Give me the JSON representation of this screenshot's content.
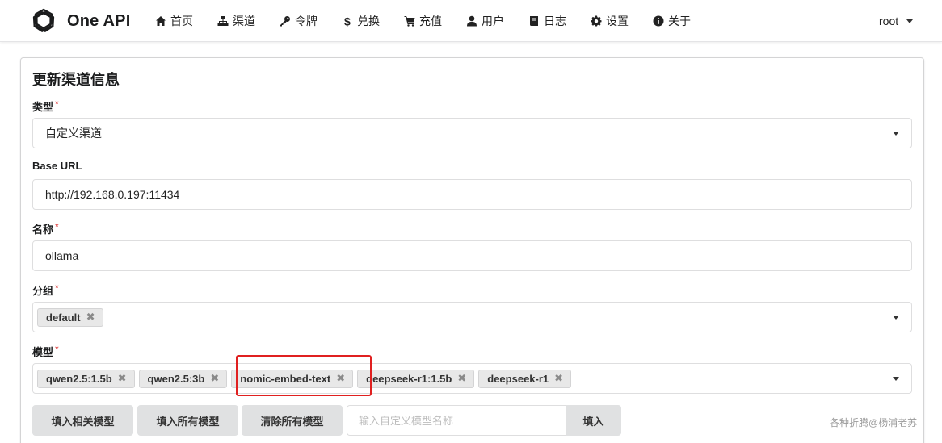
{
  "brand": {
    "name": "One API"
  },
  "nav": {
    "items": [
      {
        "label": "首页",
        "icon": "home-icon"
      },
      {
        "label": "渠道",
        "icon": "sitemap-icon"
      },
      {
        "label": "令牌",
        "icon": "key-icon"
      },
      {
        "label": "兑换",
        "icon": "dollar-icon"
      },
      {
        "label": "充值",
        "icon": "cart-icon"
      },
      {
        "label": "用户",
        "icon": "user-icon"
      },
      {
        "label": "日志",
        "icon": "book-icon"
      },
      {
        "label": "设置",
        "icon": "gear-icon"
      },
      {
        "label": "关于",
        "icon": "info-icon"
      }
    ],
    "user": "root"
  },
  "form": {
    "title": "更新渠道信息",
    "type": {
      "label": "类型",
      "required_mark": "*",
      "value": "自定义渠道"
    },
    "base_url": {
      "label": "Base URL",
      "value": "http://192.168.0.197:11434"
    },
    "name": {
      "label": "名称",
      "required_mark": "*",
      "value": "ollama"
    },
    "group": {
      "label": "分组",
      "required_mark": "*",
      "chips": [
        "default"
      ]
    },
    "models": {
      "label": "模型",
      "required_mark": "*",
      "chips": [
        "qwen2.5:1.5b",
        "qwen2.5:3b",
        "nomic-embed-text",
        "deepseek-r1:1.5b",
        "deepseek-r1"
      ]
    },
    "buttons": {
      "fill_related": "填入相关模型",
      "fill_all": "填入所有模型",
      "clear_all": "清除所有模型",
      "custom_placeholder": "输入自定义模型名称",
      "fill": "填入"
    }
  },
  "chip_remove_glyph": "✖",
  "watermark": "各种折腾@杨浦老苏",
  "colors": {
    "required": "#db2828",
    "highlight_box": "#e02020",
    "button_bg": "#e0e1e2"
  }
}
